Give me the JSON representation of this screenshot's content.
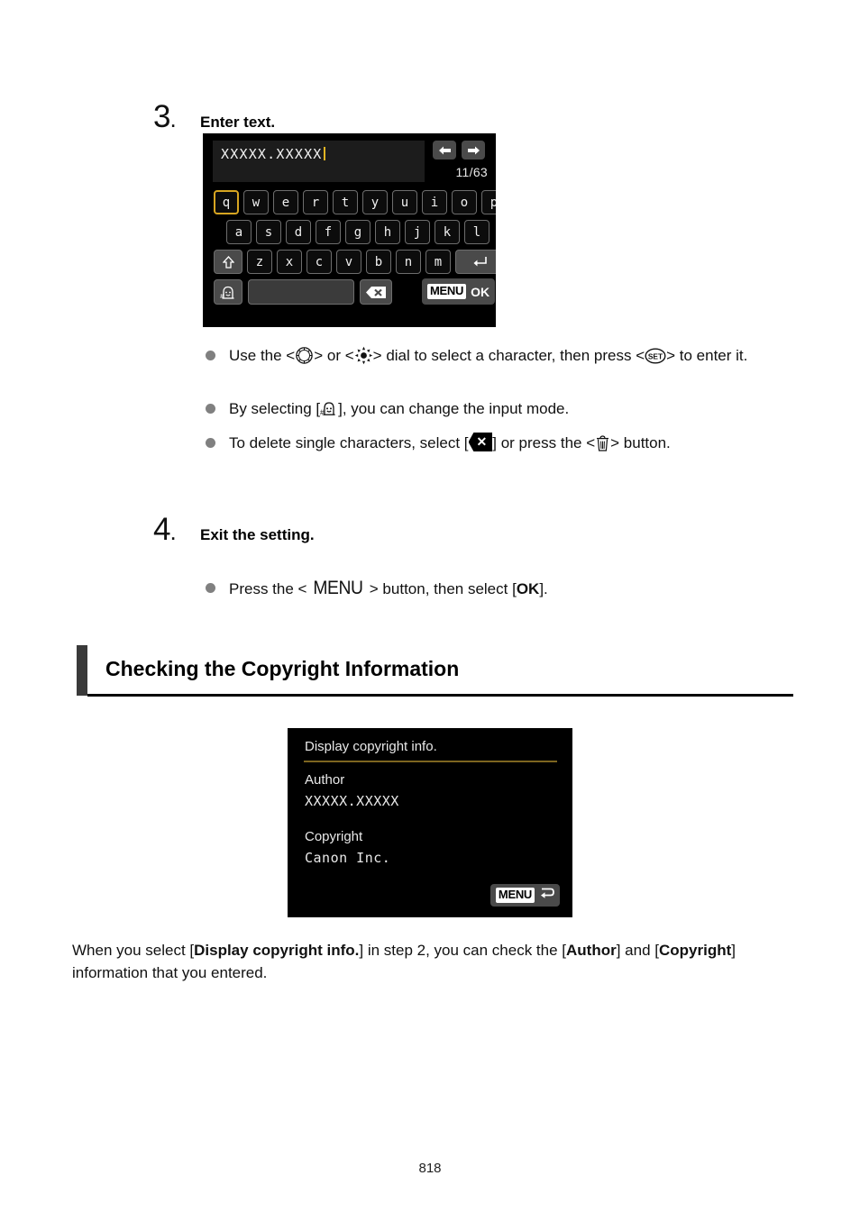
{
  "page": {
    "number": "818"
  },
  "steps": [
    {
      "number": "3",
      "dot": ".",
      "title": "Enter text."
    },
    {
      "number": "4",
      "dot": ".",
      "title": "Exit the setting."
    }
  ],
  "keyboard_screen": {
    "text_value": "XXXXX.XXXXX",
    "character_counter": "11/63",
    "arrow_left_icon": "arrow-left-icon",
    "arrow_right_icon": "arrow-right-icon",
    "rows": {
      "row1": [
        "q",
        "w",
        "e",
        "r",
        "t",
        "y",
        "u",
        "i",
        "o",
        "p"
      ],
      "row2": [
        "a",
        "s",
        "d",
        "f",
        "g",
        "h",
        "j",
        "k",
        "l"
      ],
      "row3": [
        "z",
        "x",
        "c",
        "v",
        "b",
        "n",
        "m"
      ]
    },
    "selected_key": "q",
    "shift_icon": "shift-up-arrow-icon",
    "enter_icon": "enter-return-icon",
    "input_mode_icon": "input-mode-icon",
    "space_key_label": "",
    "backspace_icon": "backspace-delete-icon",
    "menu_badge": "MENU",
    "ok_label": "OK"
  },
  "bullets_step3": [
    {
      "text_before": "Use the <",
      "icon1": "quick-control-dial-icon",
      "text_mid1": "> or <",
      "icon2": "multi-controller-icon",
      "text_mid2": "> dial to select a character, then press <",
      "icon3": "set-button-icon",
      "text_after": "> to enter it."
    },
    {
      "text_before": "By selecting [",
      "icon1": "input-mode-icon",
      "text_after": "], you can change the input mode."
    },
    {
      "text_before": "To delete single characters, select [",
      "icon1": "backspace-delete-icon",
      "text_mid1": "] or press the <",
      "icon2": "trash-erase-icon",
      "text_after": "> button."
    }
  ],
  "bullets_step4": [
    {
      "text_before": "Press the <",
      "menu_word": "MENU",
      "text_mid1": "> button, then select [",
      "ok_label": "OK",
      "text_after": "]."
    }
  ],
  "section": {
    "heading": "Checking the Copyright Information"
  },
  "copyright_screen": {
    "title": "Display copyright info.",
    "author_label": "Author",
    "author_value": "XXXXX.XXXXX",
    "copyright_label": "Copyright",
    "copyright_value": "Canon Inc.",
    "menu_badge": "MENU",
    "back_icon": "return-arrow-icon"
  },
  "closing_paragraph": {
    "part1": "When you select [",
    "bold1": "Display copyright info.",
    "part2": "] in step 2, you can check the [",
    "bold2": "Author",
    "part3": "] and [",
    "bold3": "Copyright",
    "part4": "] information that you entered."
  },
  "colors": {
    "selection_gold": "#d7a521",
    "caret_gold": "#e0b423",
    "screen_black": "#000000",
    "heading_bar_gray": "#3a3a3a",
    "bullet_gray": "#808080",
    "underline_olive": "#7d6520"
  }
}
